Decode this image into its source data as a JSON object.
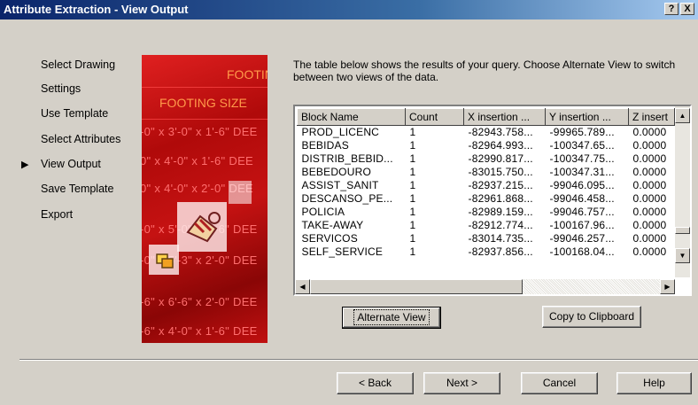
{
  "window": {
    "title": "Attribute Extraction - View Output",
    "help_btn": "?",
    "close_btn": "X"
  },
  "steps": [
    {
      "label": "Select Drawing",
      "current": false
    },
    {
      "label": "Settings",
      "current": false
    },
    {
      "label": "Use Template",
      "current": false
    },
    {
      "label": "Select Attributes",
      "current": false
    },
    {
      "label": "View Output",
      "current": true
    },
    {
      "label": "Save Template",
      "current": false
    },
    {
      "label": "Export",
      "current": false
    }
  ],
  "image_panel": {
    "header_top": "FOOTING",
    "header_size": "FOOTING SIZE",
    "rows": [
      "-0\" x 3'-0\" x 1'-6\" DEE",
      "0\" x 4'-0\" x 1'-6\" DEE",
      "0\" x 4'-0\" x 2'-0\" DEE",
      "-0\" x 5'-0\" x 2'-6\" DEE",
      "-0\" x 5'-3\" x 2'-0\" DEE",
      "-6\" x 6'-6\" x 2'-0\" DEE",
      "-6\" x 4'-0\" x 1'-6\" DEE"
    ]
  },
  "description": "The table below shows the results of your query. Choose Alternate View to switch between two views of the data.",
  "table": {
    "columns": [
      "Block Name",
      "Count",
      "X insertion ...",
      "Y insertion ...",
      "Z insert"
    ],
    "rows": [
      [
        "PROD_LICENC",
        "1",
        "-82943.758...",
        "-99965.789...",
        "0.0000"
      ],
      [
        "BEBIDAS",
        "1",
        "-82964.993...",
        "-100347.65...",
        "0.0000"
      ],
      [
        "DISTRIB_BEBID...",
        "1",
        "-82990.817...",
        "-100347.75...",
        "0.0000"
      ],
      [
        "BEBEDOURO",
        "1",
        "-83015.750...",
        "-100347.31...",
        "0.0000"
      ],
      [
        "ASSIST_SANIT",
        "1",
        "-82937.215...",
        "-99046.095...",
        "0.0000"
      ],
      [
        "DESCANSO_PE...",
        "1",
        "-82961.868...",
        "-99046.458...",
        "0.0000"
      ],
      [
        "POLICIA",
        "1",
        "-82989.159...",
        "-99046.757...",
        "0.0000"
      ],
      [
        "TAKE-AWAY",
        "1",
        "-82912.774...",
        "-100167.96...",
        "0.0000"
      ],
      [
        "SERVICOS",
        "1",
        "-83014.735...",
        "-99046.257...",
        "0.0000"
      ],
      [
        "SELF_SERVICE",
        "1",
        "-82937.856...",
        "-100168.04...",
        "0.0000"
      ]
    ]
  },
  "buttons": {
    "alternate_view": "Alternate View",
    "copy_clipboard": "Copy to Clipboard",
    "back": "< Back",
    "next": "Next >",
    "cancel": "Cancel",
    "help": "Help"
  }
}
